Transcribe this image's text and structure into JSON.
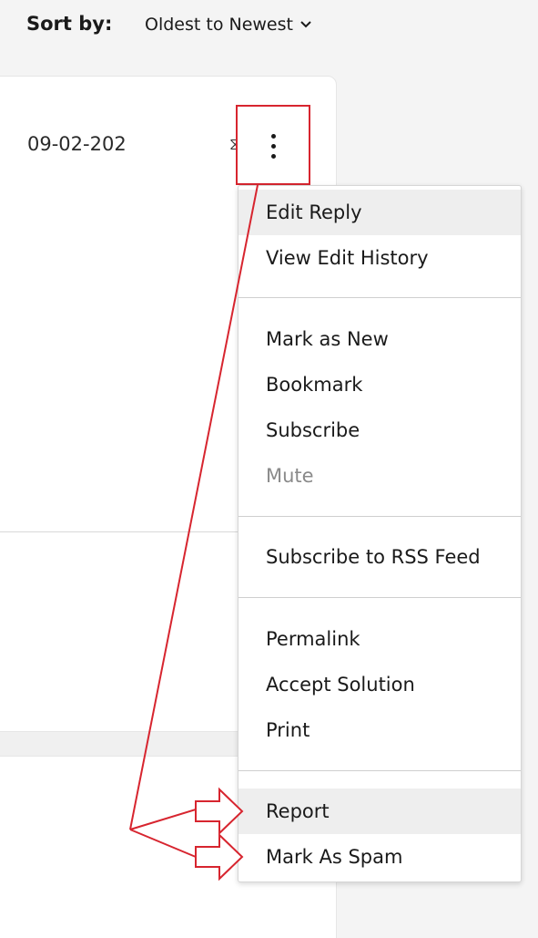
{
  "sort": {
    "label": "Sort by:",
    "selected": "Oldest to Newest"
  },
  "post": {
    "date": "09-02-202",
    "more_options_icon": "vertical-ellipsis-icon"
  },
  "menu": {
    "items": [
      {
        "label": "Edit Reply"
      },
      {
        "label": "View Edit History"
      },
      {
        "label": "Mark as New"
      },
      {
        "label": "Bookmark"
      },
      {
        "label": "Subscribe"
      },
      {
        "label": "Mute"
      },
      {
        "label": "Subscribe to RSS Feed"
      },
      {
        "label": "Permalink"
      },
      {
        "label": "Accept Solution"
      },
      {
        "label": "Print"
      },
      {
        "label": "Report"
      },
      {
        "label": "Mark As Spam"
      }
    ]
  },
  "colors": {
    "annotation": "#d7252f",
    "menu_highlight": "#eeeeee",
    "disabled_text": "#8a8a8a",
    "page_background": "#f4f4f4"
  }
}
